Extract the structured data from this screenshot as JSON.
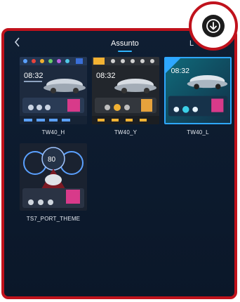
{
  "header": {
    "back_glyph": "<",
    "tabs": [
      {
        "label": "Assunto",
        "active": true
      },
      {
        "label": "L",
        "active": false
      }
    ]
  },
  "themes": [
    {
      "name": "TW40_H",
      "selected": false,
      "clock": "08:32"
    },
    {
      "name": "TW40_Y",
      "selected": false,
      "clock": "08:32"
    },
    {
      "name": "TW40_L",
      "selected": true,
      "clock": "08:32"
    },
    {
      "name": "TS7_PORT_THEME",
      "selected": false,
      "speed": "80"
    }
  ],
  "colors": {
    "accent": "#2fb5ff",
    "highlight_border": "#c0121c",
    "panel_bg": "#0f1e33"
  },
  "icons": {
    "back": "chevron-left-icon",
    "download": "download-circle-icon"
  }
}
